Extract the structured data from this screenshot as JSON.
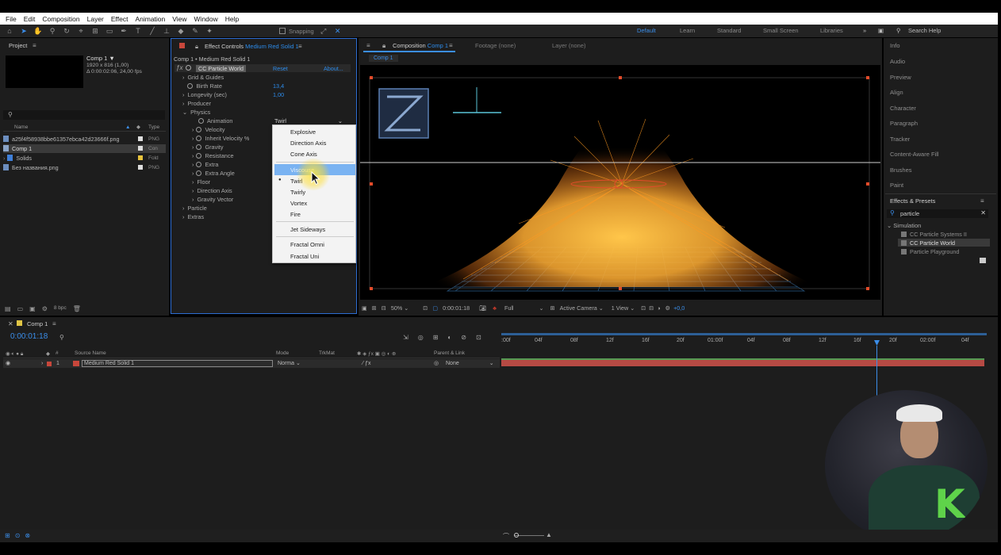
{
  "menu": [
    "File",
    "Edit",
    "Composition",
    "Layer",
    "Effect",
    "Animation",
    "View",
    "Window",
    "Help"
  ],
  "toolbar": {
    "snapping": "Snapping",
    "workspaces": [
      "Default",
      "Learn",
      "Standard",
      "Small Screen",
      "Libraries"
    ],
    "active_workspace": "Default",
    "search_help": "Search Help"
  },
  "project": {
    "title": "Project",
    "comp_name": "Comp 1 ▼",
    "comp_size": "1920 x 816 (1,00)",
    "comp_duration": "Δ 0:00:02:06, 24,00 fps",
    "search_placeholder": "",
    "col_name": "Name",
    "col_type": "Type",
    "items": [
      {
        "name": "a25f4f58938bbe61357ebca42d23666f.png",
        "type": "PNG"
      },
      {
        "name": "Comp 1",
        "type": "Con"
      },
      {
        "name": "Solids",
        "type": "Fold"
      },
      {
        "name": "Без названия.png",
        "type": "PNG"
      }
    ],
    "bpc": "8 bpc"
  },
  "effect_controls": {
    "title": "Effect Controls",
    "layer": "Medium Red Solid 1",
    "subtitle": "Comp 1 • Medium Red Solid 1",
    "effect_name": "CC Particle World",
    "reset": "Reset",
    "about": "About...",
    "params": [
      {
        "label": "Grid & Guides",
        "value": ""
      },
      {
        "label": "Birth Rate",
        "value": "13,4"
      },
      {
        "label": "Longevity (sec)",
        "value": "1,00"
      },
      {
        "label": "Producer",
        "value": ""
      },
      {
        "label": "Physics",
        "value": ""
      },
      {
        "label": "Animation",
        "value": "Twirl"
      },
      {
        "label": "Velocity",
        "value": ""
      },
      {
        "label": "Inherit Velocity %",
        "value": ""
      },
      {
        "label": "Gravity",
        "value": ""
      },
      {
        "label": "Resistance",
        "value": ""
      },
      {
        "label": "Extra",
        "value": ""
      },
      {
        "label": "Extra Angle",
        "value": ""
      },
      {
        "label": "Floor",
        "value": ""
      },
      {
        "label": "Direction Axis",
        "value": ""
      },
      {
        "label": "Gravity Vector",
        "value": ""
      },
      {
        "label": "Particle",
        "value": ""
      },
      {
        "label": "Extras",
        "value": ""
      }
    ]
  },
  "dropdown": {
    "options": [
      "Explosive",
      "Direction Axis",
      "Cone Axis",
      "Viscouse",
      "Twirl",
      "Twirly",
      "Vortex",
      "Fire",
      "Jet Sideways",
      "Fractal Omni",
      "Fractal Uni"
    ],
    "selected": "Twirl",
    "hovered": "Viscouse"
  },
  "composition": {
    "tab": "Composition",
    "tab_comp": "Comp 1",
    "footage": "Footage (none)",
    "layer": "Layer (none)",
    "breadcrumb": "Comp 1",
    "zoom": "50%",
    "timecode": "0:00:01:18",
    "resolution": "Full",
    "camera": "Active Camera",
    "views": "1 View",
    "exposure": "+0,0"
  },
  "right_panels": {
    "items": [
      "Info",
      "Audio",
      "Preview",
      "Align",
      "Character",
      "Paragraph",
      "Tracker",
      "Content-Aware Fill",
      "Brushes",
      "Paint"
    ],
    "effects_presets": "Effects & Presets",
    "search_value": "particle",
    "category": "Simulation",
    "results": [
      "CC Particle Systems II",
      "CC Particle World",
      "Particle Playground"
    ],
    "highlighted": "CC Particle World"
  },
  "timeline": {
    "tab": "Comp 1",
    "timecode": "0:00:01:18",
    "col_source": "Source Name",
    "col_mode": "Mode",
    "col_trkmat": "TrkMat",
    "col_parent": "Parent & Link",
    "layer_index": "1",
    "layer_name": "Medium Red Solid 1",
    "layer_mode": "Norma",
    "layer_parent": "None",
    "ruler": [
      ":00f",
      "04f",
      "08f",
      "12f",
      "16f",
      "20f",
      "01:00f",
      "04f",
      "08f",
      "12f",
      "16f",
      "20f",
      "02:00f",
      "04f"
    ]
  },
  "watermark_text": "K"
}
